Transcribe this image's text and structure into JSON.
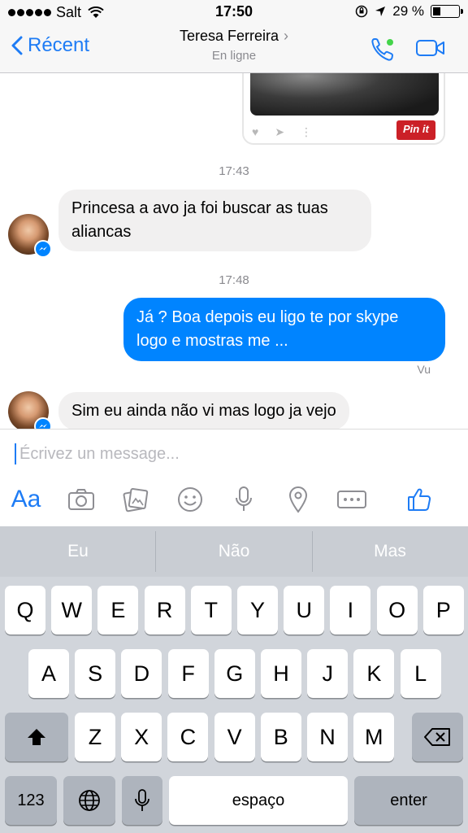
{
  "status": {
    "carrier": "Salt",
    "time": "17:50",
    "battery": "29 %",
    "battery_fraction": 0.29
  },
  "nav": {
    "back_label": "Récent",
    "contact_name": "Teresa Ferreira",
    "presence": "En ligne",
    "call_icon": "phone-icon",
    "video_icon": "video-icon"
  },
  "pin": {
    "button_label": "Pin it"
  },
  "messages": {
    "ts1": "17:43",
    "m1": "Princesa a avo ja foi buscar as tuas aliancas",
    "ts2": "17:48",
    "m2": "Já ? Boa depois eu ligo te por skype logo e mostras me ...",
    "seen": "Vu",
    "m3": "Sim eu ainda não vi mas logo ja vejo"
  },
  "composer": {
    "placeholder": "Écrivez un message...",
    "aa_label": "Aa",
    "tools": [
      "camera-icon",
      "gallery-icon",
      "emoji-icon",
      "microphone-icon",
      "location-icon",
      "more-icon",
      "like-icon"
    ]
  },
  "keyboard": {
    "suggestions": [
      "Eu",
      "Não",
      "Mas"
    ],
    "row1": [
      "Q",
      "W",
      "E",
      "R",
      "T",
      "Y",
      "U",
      "I",
      "O",
      "P"
    ],
    "row2": [
      "A",
      "S",
      "D",
      "F",
      "G",
      "H",
      "J",
      "K",
      "L"
    ],
    "row3": [
      "Z",
      "X",
      "C",
      "V",
      "B",
      "N",
      "M"
    ],
    "numbers_label": "123",
    "space_label": "espaço",
    "enter_label": "enter"
  },
  "colors": {
    "accent": "#1e7cf5",
    "bubble_out": "#0084ff",
    "bubble_in": "#f1f0f0",
    "online": "#44d44a",
    "pinterest": "#cb2027"
  }
}
